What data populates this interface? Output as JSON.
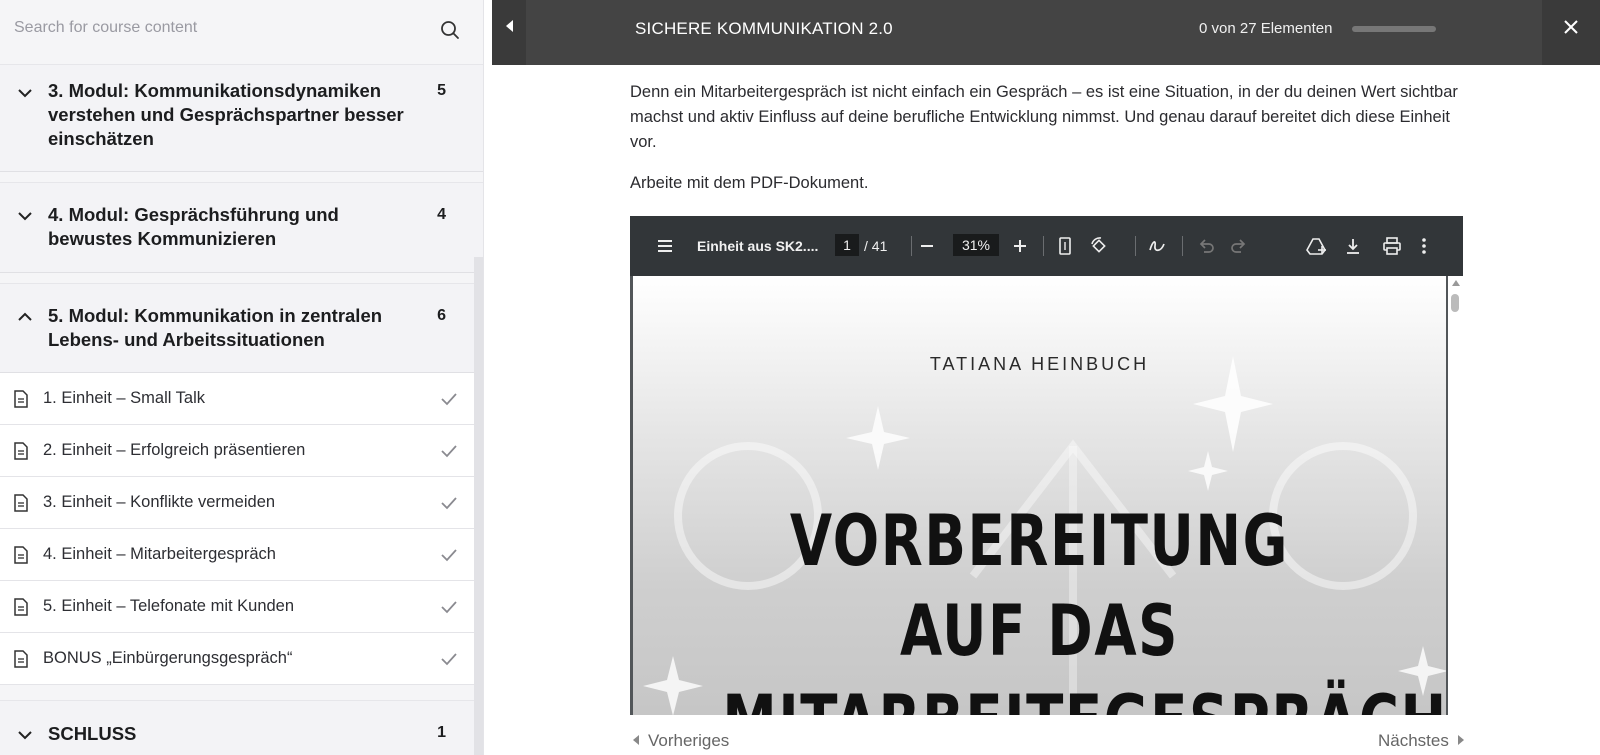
{
  "sidebar": {
    "search_placeholder": "Search for course content",
    "modules": [
      {
        "title": "3. Modul: Kommunikationsdynamiken verstehen und Gesprächspartner besser einschätzen",
        "count": "5",
        "expanded": false
      },
      {
        "title": "4. Modul: Gesprächsführung und bewustes Kommunizieren",
        "count": "4",
        "expanded": false
      },
      {
        "title": "5. Modul: Kommunikation in zentralen Lebens- und Arbeitssituationen",
        "count": "6",
        "expanded": true
      },
      {
        "title": "SCHLUSS",
        "count": "1",
        "expanded": false
      }
    ],
    "units": [
      {
        "label": "1. Einheit – Small Talk",
        "completed": true
      },
      {
        "label": "2. Einheit – Erfolgreich präsentieren",
        "completed": true
      },
      {
        "label": "3. Einheit – Konflikte vermeiden",
        "completed": true
      },
      {
        "label": "4. Einheit – Mitarbeitergespräch",
        "completed": true
      },
      {
        "label": "5. Einheit – Telefonate mit Kunden",
        "completed": true
      },
      {
        "label": "BONUS „Einbürgerungsgespräch“",
        "completed": true
      }
    ]
  },
  "header": {
    "course_title": "SICHERE KOMMUNIKATION 2.0",
    "progress_text": "0 von 27 Elementen",
    "progress_fraction": 0
  },
  "content": {
    "paragraph1": "Denn ein Mitarbeitergespräch ist nicht einfach ein Gespräch – es ist eine Situation, in der du deinen Wert sichtbar machst und aktiv Einfluss auf deine berufliche Entwicklung nimmst. Und genau darauf bereitet dich diese Einheit vor.",
    "paragraph2": "Arbeite mit dem PDF-Dokument."
  },
  "pdf": {
    "file_name": "Einheit aus SK2....",
    "page": "1",
    "total_pages": "/ 41",
    "zoom": "31%",
    "page_author": "TATIANA HEINBUCH",
    "page_title_line1": "VORBEREITUNG AUF DAS",
    "page_title_line2": "MITARBEITEGESPRÄCH"
  },
  "nav": {
    "previous": "Vorheriges",
    "next": "Nächstes"
  },
  "colors": {
    "topbar": "#444444",
    "pdf_toolbar": "#323639",
    "sidebar_bg": "#f5f5f7"
  }
}
